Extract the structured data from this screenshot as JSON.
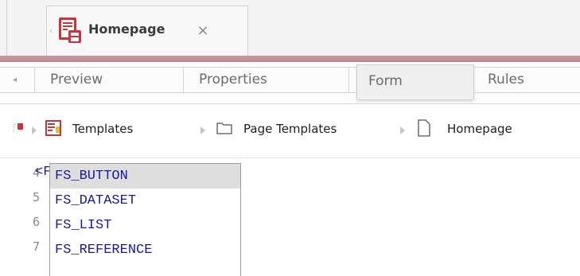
{
  "document_tab": {
    "title": "Homepage",
    "close_glyph": "×",
    "nav_arrow_glyph": "‹",
    "icon": "page-template-icon"
  },
  "accent_color": "#b98790",
  "view_tabs": {
    "nav_glyph": "◂",
    "tabs": [
      {
        "label": "Preview",
        "active": false
      },
      {
        "label": "Properties",
        "active": false
      },
      {
        "label": "Form",
        "active": true
      },
      {
        "label": "Rules",
        "active": false
      }
    ]
  },
  "breadcrumb": {
    "root_icon": "project-icon",
    "items": [
      {
        "label": "Templates",
        "icon": "templates-icon"
      },
      {
        "label": "Page Templates",
        "icon": "folder-icon"
      },
      {
        "label": "Homepage",
        "icon": "document-icon"
      }
    ]
  },
  "editor": {
    "line_numbers": [
      "4",
      "5",
      "6",
      "7"
    ],
    "line4_text": "<F",
    "autocomplete": {
      "items": [
        "FS_BUTTON",
        "FS_DATASET",
        "FS_LIST",
        "FS_REFERENCE"
      ],
      "selected_index": 0
    }
  }
}
